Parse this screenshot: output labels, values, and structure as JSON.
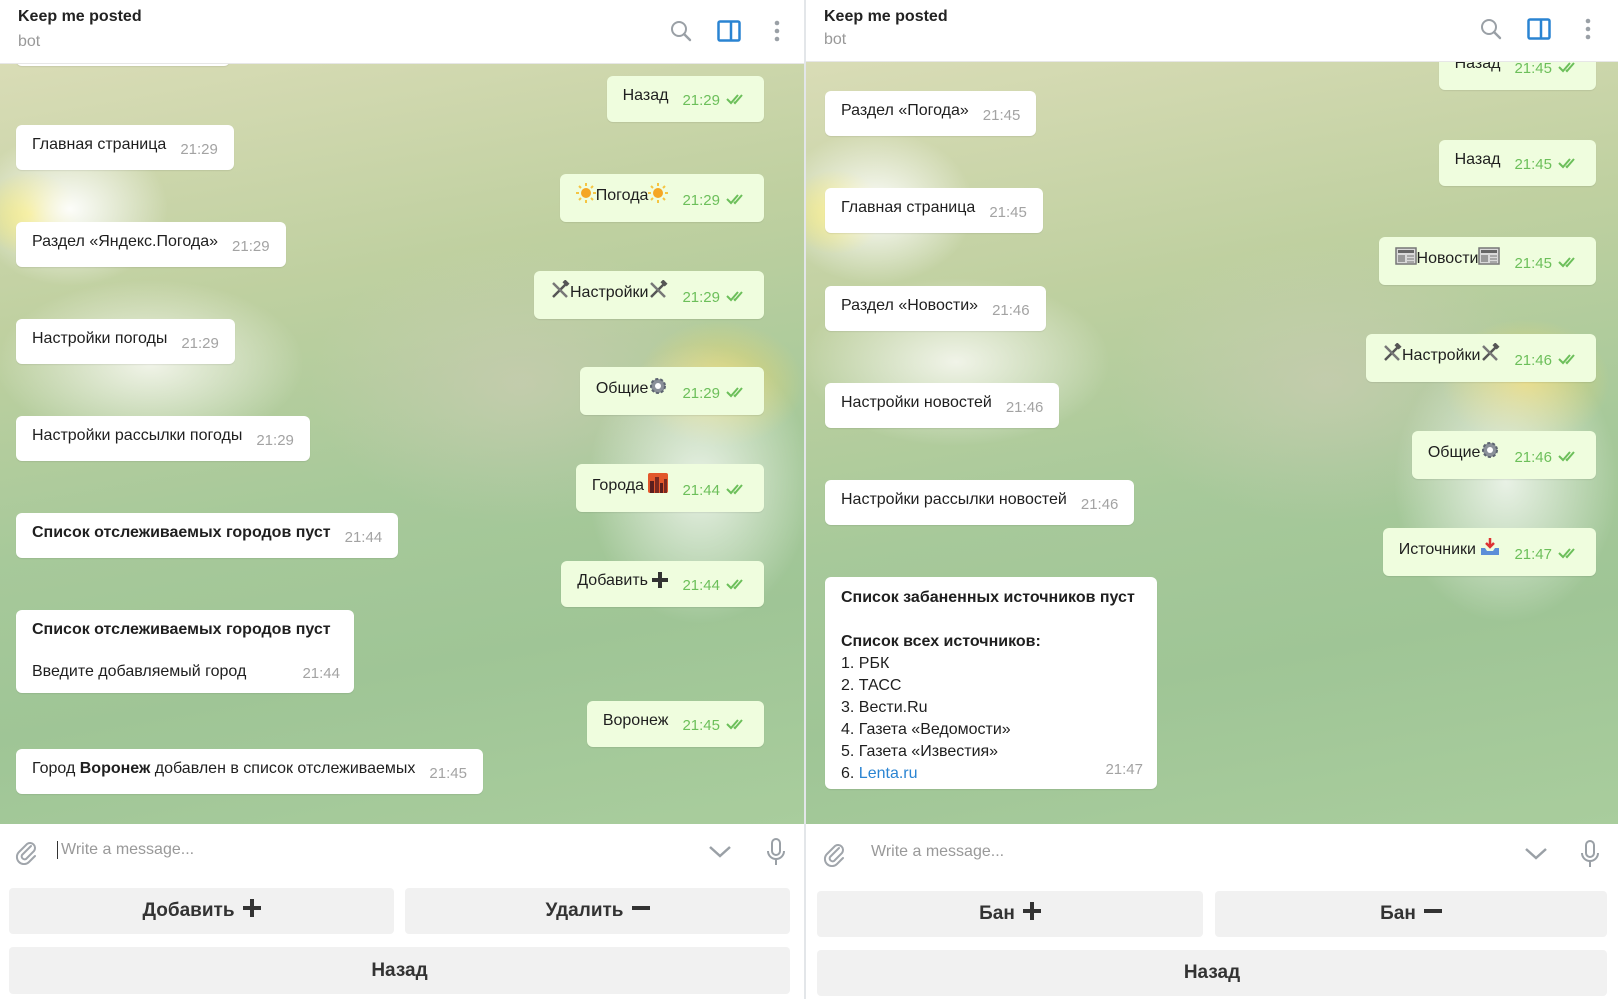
{
  "left": {
    "header": {
      "title": "Keep me posted",
      "subtitle": "bot"
    },
    "composer": {
      "placeholder": "Write a message..."
    },
    "messages": [
      {
        "dir": "out",
        "text": "Назад",
        "time": "21:29"
      },
      {
        "dir": "in",
        "text": "Главная страница",
        "time": "21:29"
      },
      {
        "dir": "out",
        "text": "Погода",
        "time": "21:29"
      },
      {
        "dir": "in",
        "text": "Раздел «Яндекс.Погода»",
        "time": "21:29"
      },
      {
        "dir": "out",
        "text": "Настройки",
        "time": "21:29"
      },
      {
        "dir": "in",
        "text": "Настройки погоды",
        "time": "21:29"
      },
      {
        "dir": "out",
        "text": "Общие",
        "time": "21:29"
      },
      {
        "dir": "in",
        "text": "Настройки рассылки погоды",
        "time": "21:29"
      },
      {
        "dir": "out",
        "text": "Города",
        "time": "21:44"
      },
      {
        "dir": "in",
        "text": "Список отслеживаемых городов пуст",
        "time": "21:44"
      },
      {
        "dir": "out",
        "text": "Добавить",
        "time": "21:44"
      },
      {
        "dir": "in",
        "line1": "Список отслеживаемых городов пуст",
        "line2": "Введите добавляемый город",
        "time": "21:44"
      },
      {
        "dir": "out",
        "text": "Воронеж",
        "time": "21:45"
      },
      {
        "dir": "in",
        "pre": "Город",
        "bold": "Воронеж",
        "post": "добавлен в список отслеживаемых",
        "time": "21:45"
      }
    ],
    "keyboard": {
      "add": "Добавить",
      "remove": "Удалить",
      "back": "Назад"
    }
  },
  "right": {
    "header": {
      "title": "Keep me posted",
      "subtitle": "bot"
    },
    "composer": {
      "placeholder": "Write a message..."
    },
    "messages": [
      {
        "dir": "out",
        "text": "Назад",
        "time": "21:45"
      },
      {
        "dir": "in",
        "text": "Раздел «Погода»",
        "time": "21:45"
      },
      {
        "dir": "out",
        "text": "Назад",
        "time": "21:45"
      },
      {
        "dir": "in",
        "text": "Главная страница",
        "time": "21:45"
      },
      {
        "dir": "out",
        "text": "Новости",
        "time": "21:45"
      },
      {
        "dir": "in",
        "text": "Раздел «Новости»",
        "time": "21:46"
      },
      {
        "dir": "out",
        "text": "Настройки",
        "time": "21:46"
      },
      {
        "dir": "in",
        "text": "Настройки новостей",
        "time": "21:46"
      },
      {
        "dir": "out",
        "text": "Общие",
        "time": "21:46"
      },
      {
        "dir": "in",
        "text": "Настройки рассылки новостей",
        "time": "21:46"
      },
      {
        "dir": "out",
        "text": "Источники",
        "time": "21:47"
      },
      {
        "dir": "in",
        "banned_title": "Список забаненных источников пуст",
        "all_title": "Список всех источников:",
        "items": [
          "1. РБК",
          "2. ТАСС",
          "3. Вести.Ru",
          "4. Газета «Ведомости»",
          "5. Газета «Известия»"
        ],
        "item6_prefix": "6.",
        "item6_link": "Lenta.ru",
        "time": "21:47"
      }
    ],
    "keyboard": {
      "ban_add": "Бан",
      "ban_remove": "Бан",
      "back": "Назад"
    }
  },
  "colors": {
    "out_bubble": "#effdde",
    "in_bubble": "#ffffff",
    "tick": "#6cbf5a",
    "accent": "#2a84d2"
  }
}
